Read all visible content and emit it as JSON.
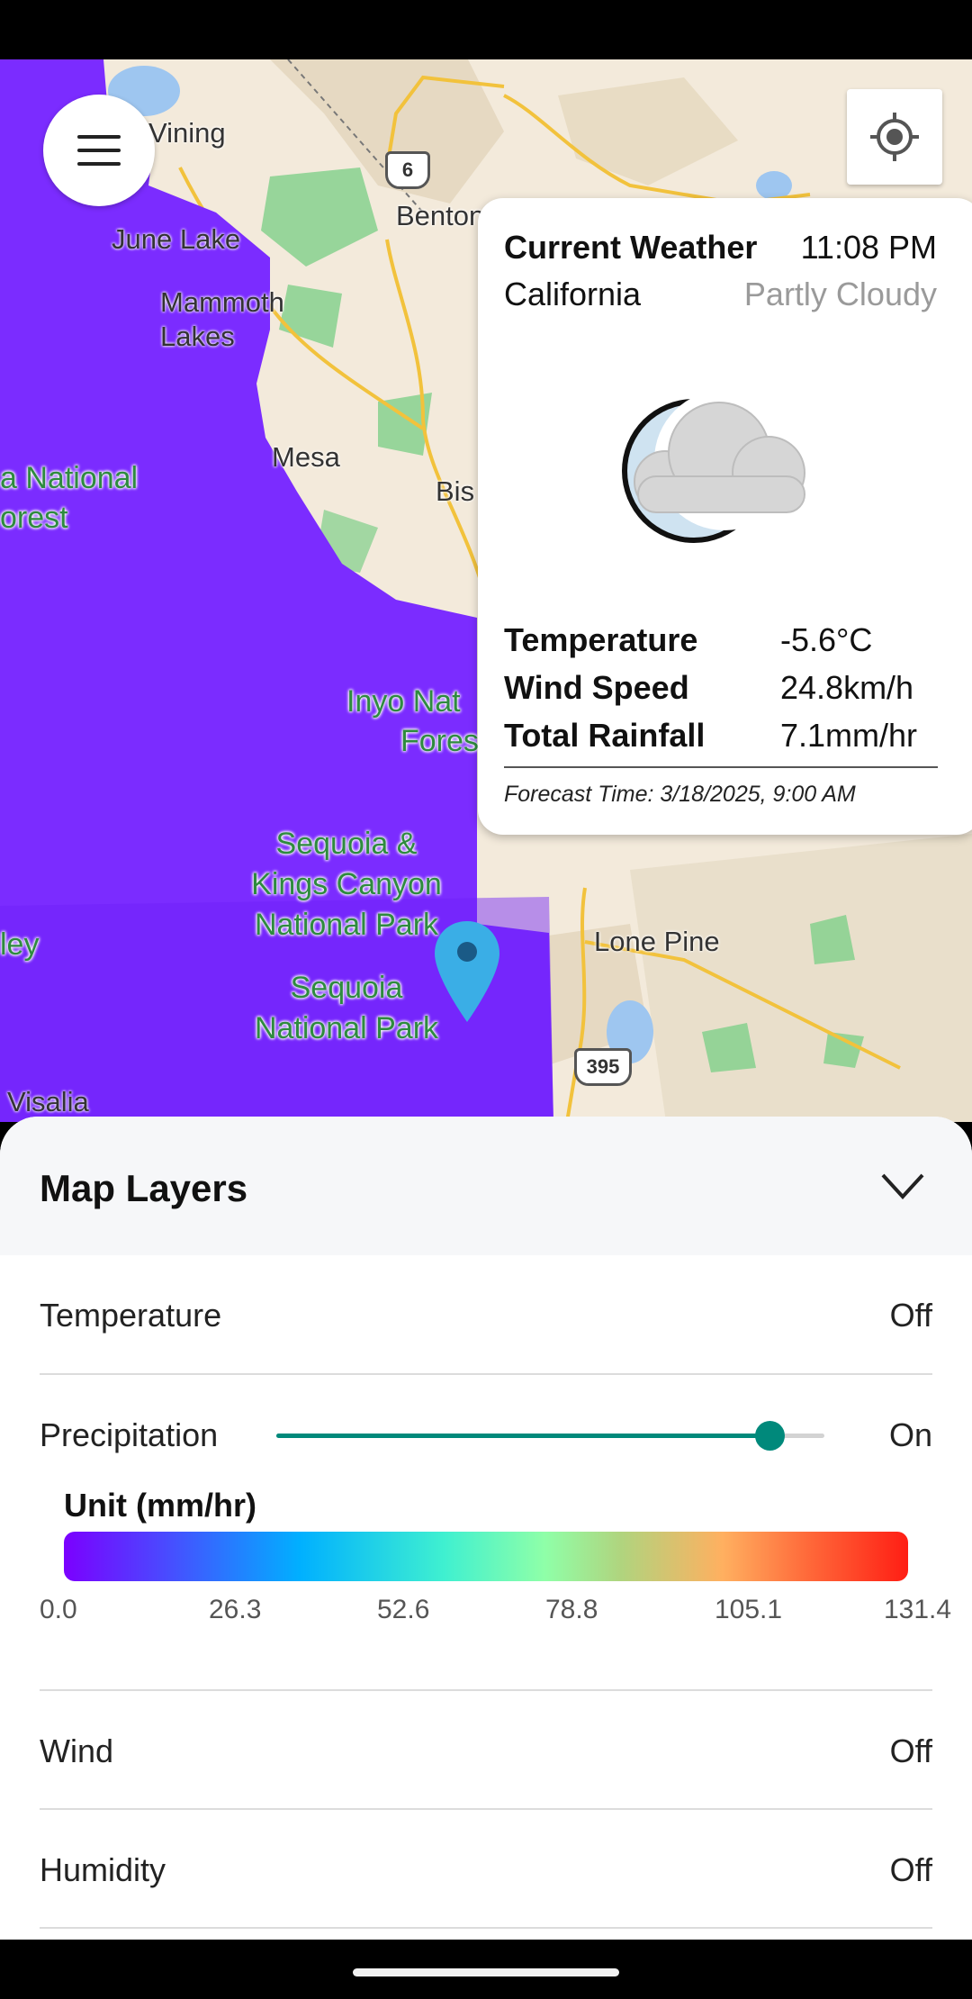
{
  "map": {
    "labels": {
      "vining": "Vining",
      "june_lake": "June Lake",
      "benton": "Benton",
      "mammoth": "Mammoth",
      "lakes": "Lakes",
      "mesa": "Mesa",
      "bishop": "Bis",
      "national": "a National",
      "forest": "orest",
      "inyo1": "Inyo Nat",
      "inyo2": "Fores",
      "skc1": "Sequoia &",
      "skc2": "Kings Canyon",
      "skc3": "National Park",
      "seq1": "Sequoia",
      "seq2": "National Park",
      "valley": "ley",
      "visalia": "Visalia",
      "lone_pine": "Lone Pine",
      "hwy6": "6",
      "hwy395": "395"
    },
    "overlay_color": "#7b2cff"
  },
  "weather": {
    "title": "Current Weather",
    "time": "11:08 PM",
    "region": "California",
    "condition": "Partly Cloudy",
    "icon": "partly-cloudy-night-icon",
    "rows": [
      {
        "label": "Temperature",
        "value": "-5.6°C"
      },
      {
        "label": "Wind Speed",
        "value": "24.8km/h"
      },
      {
        "label": "Total Rainfall",
        "value": "7.1mm/hr"
      }
    ],
    "forecast": "Forecast Time: 3/18/2025, 9:00 AM"
  },
  "layers": {
    "title": "Map Layers",
    "temperature": {
      "label": "Temperature",
      "state": "Off"
    },
    "precipitation": {
      "label": "Precipitation",
      "state": "On",
      "slider_fraction": 0.9
    },
    "unit_label": "Unit (mm/hr)",
    "scale_ticks": [
      "0.0",
      "26.3",
      "52.6",
      "78.8",
      "105.1",
      "131.4"
    ],
    "wind": {
      "label": "Wind",
      "state": "Off"
    },
    "humidity": {
      "label": "Humidity",
      "state": "Off"
    }
  },
  "colors": {
    "accent": "#00897b",
    "precip_overlay": "#7b2cff"
  }
}
